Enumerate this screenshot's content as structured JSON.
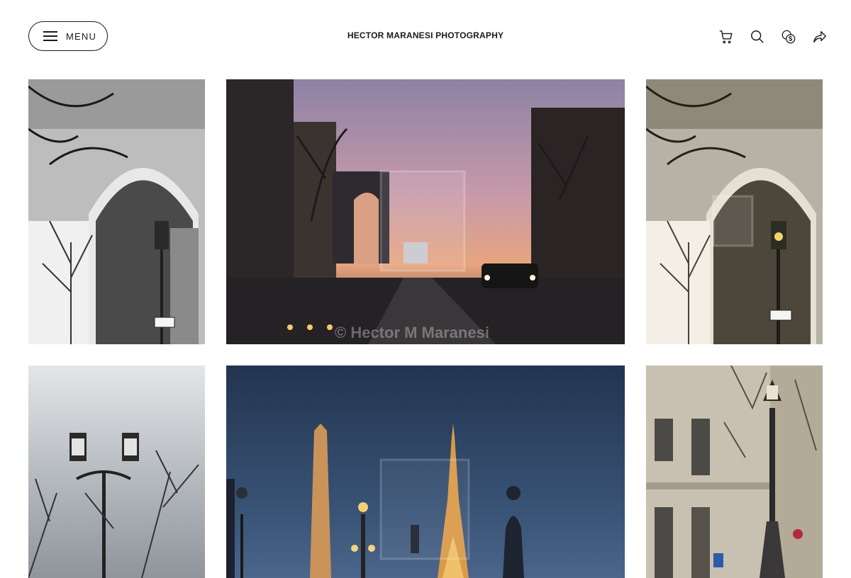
{
  "header": {
    "menu_label": "MENU",
    "site_title": "HECTOR MARANESI PHOTOGRAPHY",
    "icons": [
      "cart-icon",
      "search-icon",
      "currency-icon",
      "share-icon"
    ]
  },
  "gallery": {
    "watermark_text": "© Hector M Maranesi",
    "photos": [
      {
        "subject": "Arc de Triomphe black and white"
      },
      {
        "subject": "Arc de Triomphe at sunset street"
      },
      {
        "subject": "Arc de Triomphe with lamp post color"
      },
      {
        "subject": "Street lamps against cloudy sky"
      },
      {
        "subject": "Obelisk and Eiffel Tower at dusk"
      },
      {
        "subject": "Ornate lamp post with Paris building"
      }
    ]
  },
  "colors": {
    "text": "#1a1a1a",
    "background": "#ffffff"
  }
}
